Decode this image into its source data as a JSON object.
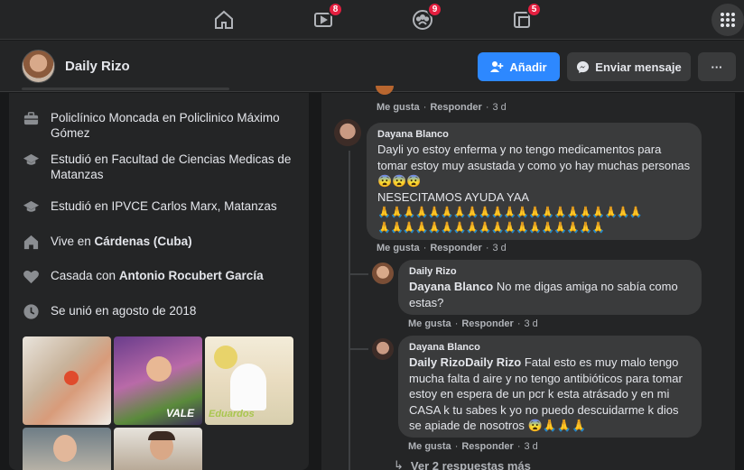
{
  "nav": {
    "badges": {
      "watch": "8",
      "groups": "9",
      "gaming": "5"
    }
  },
  "profile": {
    "name": "Daily Rizo",
    "add_label": "Añadir",
    "message_label": "Enviar mensaje",
    "more_label": "···"
  },
  "intro": {
    "items": [
      {
        "icon": "briefcase-icon",
        "text": "Policlínico Moncada en Policlinico Máximo Gómez"
      },
      {
        "icon": "graduation-cap-icon",
        "text": "Estudió en Facultad de Ciencias Medicas de Matanzas"
      },
      {
        "icon": "graduation-cap-icon",
        "text": "Estudió en IPVCE Carlos Marx, Matanzas"
      },
      {
        "icon": "home-icon",
        "prefix": "Vive en ",
        "bold": "Cárdenas (Cuba)"
      },
      {
        "icon": "heart-icon",
        "prefix": "Casada con ",
        "bold": "Antonio Rocubert García"
      },
      {
        "icon": "clock-icon",
        "text": "Se unió en agosto de 2018"
      }
    ],
    "photo_tags": {
      "p2": "VALE",
      "p3": "Eduardos"
    }
  },
  "comments": {
    "top_actions": {
      "like": "Me gusta",
      "reply": "Responder",
      "time": "3 d"
    },
    "c1": {
      "author": "Dayana Blanco",
      "text": "Dayli yo estoy enferma y no tengo medicamentos para tomar estoy muy asustada y como yo hay muchas personas 😨😨😨",
      "text2": "NESECITAMOS AYUDA YAA",
      "emoji_row1": "🙏🙏🙏🙏🙏🙏🙏🙏🙏🙏🙏🙏🙏🙏🙏🙏🙏🙏🙏🙏🙏",
      "emoji_row2": "🙏🙏🙏🙏🙏🙏🙏🙏🙏🙏🙏🙏🙏🙏🙏🙏🙏🙏",
      "like": "Me gusta",
      "reply": "Responder",
      "time": "3 d"
    },
    "c2": {
      "author": "Daily Rizo",
      "mention": "Dayana Blanco",
      "text": " No me digas amiga no sabía como estas?",
      "like": "Me gusta",
      "reply": "Responder",
      "time": "3 d"
    },
    "c3": {
      "author": "Dayana Blanco",
      "mention": "Daily RizoDaily Rizo",
      "text": " Fatal esto es muy malo tengo mucha falta d aire y no tengo antibióticos para tomar estoy en espera de un pcr k esta atrásado y en mi CASA k tu sabes k yo no puedo descuidarme k dios se apiade de nosotros 😨🙏🙏🙏",
      "like": "Me gusta",
      "reply": "Responder",
      "time": "3 d"
    },
    "more_replies": "Ver 2 respuestas más"
  },
  "colors": {
    "accent": "#2d88ff",
    "badge": "#e41e3f",
    "bg": "#18191a",
    "card": "#242526",
    "bubble": "#3a3b3c"
  }
}
